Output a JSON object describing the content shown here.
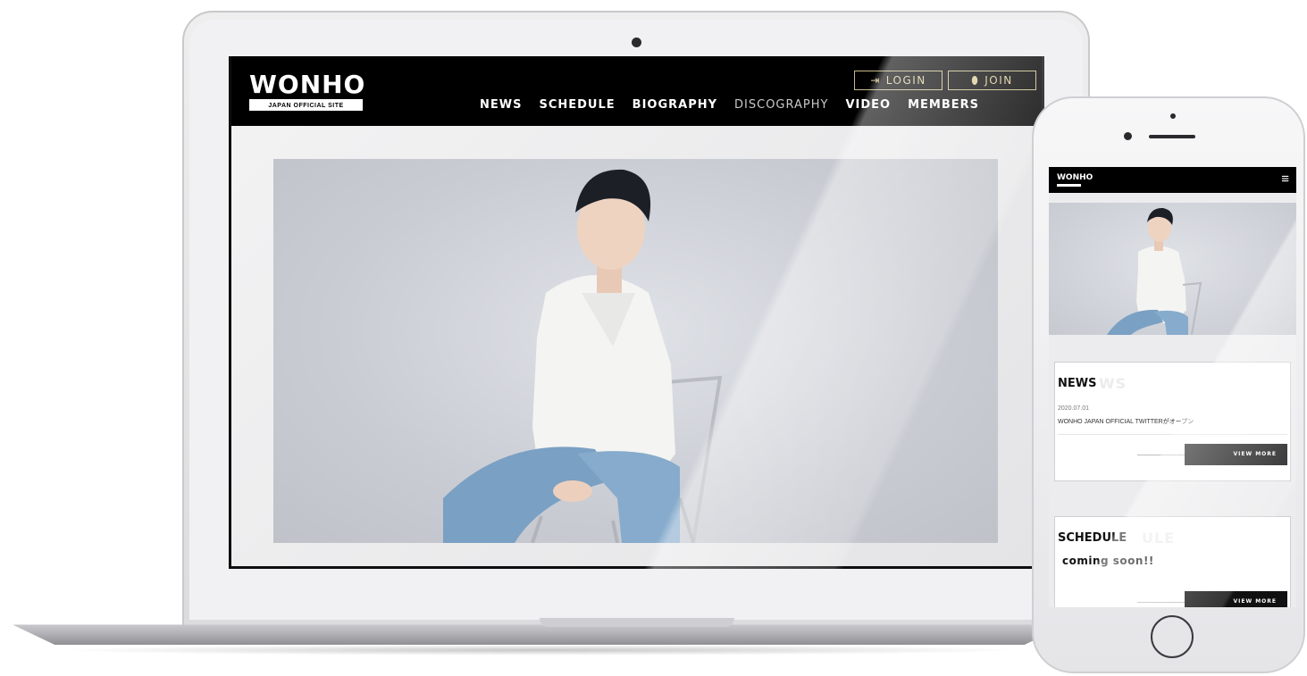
{
  "laptop_site": {
    "logo": "WONHO",
    "logo_subtitle": "JAPAN OFFICIAL SITE",
    "login_label": "LOGIN",
    "join_label": "JOIN",
    "nav": [
      "NEWS",
      "SCHEDULE",
      "BIOGRAPHY",
      "DISCOGRAPHY",
      "VIDEO",
      "MEMBERS"
    ],
    "nav_colors": [
      "#ffffff",
      "#ffffff",
      "#ffffff",
      "#c9c9c9",
      "#ffffff",
      "#ffffff"
    ]
  },
  "mobile_site": {
    "logo": "WONHO",
    "menu_icon": "hamburger-icon",
    "news": {
      "title": "NEWS",
      "ghost_title": "WS",
      "date": "2020.07.01",
      "headline": "WONHO JAPAN OFFICIAL TWITTERがオープン",
      "view_more": "VIEW MORE"
    },
    "schedule": {
      "title": "SCHEDULE",
      "ghost_title": "ULE",
      "message": "coming soon!!",
      "view_more": "VIEW MORE"
    }
  },
  "colors": {
    "header_bg": "#000000",
    "accent_gold": "#d9c996",
    "hero_bg": "#c9ccd3"
  }
}
